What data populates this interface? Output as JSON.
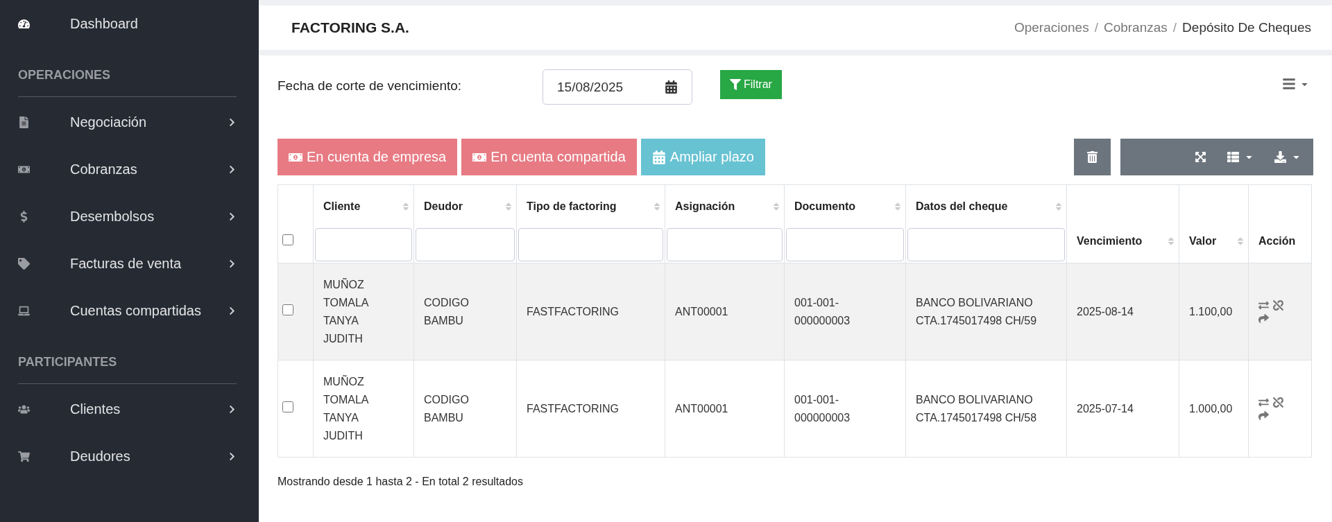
{
  "sidebar": {
    "top": [
      {
        "label": "Dashboard"
      }
    ],
    "sections": [
      {
        "title": "OPERACIONES",
        "items": [
          {
            "label": "Negociación"
          },
          {
            "label": "Cobranzas"
          },
          {
            "label": "Desembolsos"
          },
          {
            "label": "Facturas de venta"
          },
          {
            "label": "Cuentas compartidas"
          }
        ]
      },
      {
        "title": "PARTICIPANTES",
        "items": [
          {
            "label": "Clientes"
          },
          {
            "label": "Deudores"
          }
        ]
      }
    ]
  },
  "header": {
    "title": "FACTORING S.A.",
    "breadcrumb": [
      "Operaciones",
      "Cobranzas",
      "Depósito De Cheques"
    ],
    "separator": "/"
  },
  "filter": {
    "label": "Fecha de corte de vencimiento:",
    "date": "15/08/2025",
    "button": "Filtrar"
  },
  "actions": [
    {
      "label": "En cuenta de empresa",
      "kind": "danger"
    },
    {
      "label": "En cuenta compartida",
      "kind": "danger"
    },
    {
      "label": "Ampliar plazo",
      "kind": "info"
    }
  ],
  "table": {
    "select_all": {
      "checked": false
    },
    "columns": [
      {
        "label": "Cliente",
        "sortable": true,
        "filterable": true
      },
      {
        "label": "Deudor",
        "sortable": true,
        "filterable": true
      },
      {
        "label": "Tipo de factoring",
        "sortable": true,
        "filterable": true
      },
      {
        "label": "Asignación",
        "sortable": true,
        "filterable": true
      },
      {
        "label": "Documento",
        "sortable": true,
        "filterable": true
      },
      {
        "label": "Datos del cheque",
        "sortable": true,
        "filterable": true
      },
      {
        "label": "Vencimiento",
        "sortable": true,
        "filterable": false
      },
      {
        "label": "Valor",
        "sortable": true,
        "filterable": false
      },
      {
        "label": "Acción",
        "sortable": false,
        "filterable": false
      }
    ],
    "rows": [
      {
        "checked": false,
        "cells": [
          "MUÑOZ TOMALA TANYA JUDITH",
          "CODIGO BAMBU",
          "FASTFACTORING",
          "ANT00001",
          "001-001-000000003",
          "BANCO BOLIVARIANO CTA.1745017498 CH/59",
          "2025-08-14",
          "1.100,00"
        ]
      },
      {
        "checked": false,
        "cells": [
          "MUÑOZ TOMALA TANYA JUDITH",
          "CODIGO BAMBU",
          "FASTFACTORING",
          "ANT00001",
          "001-001-000000003",
          "BANCO BOLIVARIANO CTA.1745017498 CH/58",
          "2025-07-14",
          "1.000,00"
        ]
      }
    ]
  },
  "footer": "Mostrando desde 1 hasta 2 - En total 2 resultados"
}
